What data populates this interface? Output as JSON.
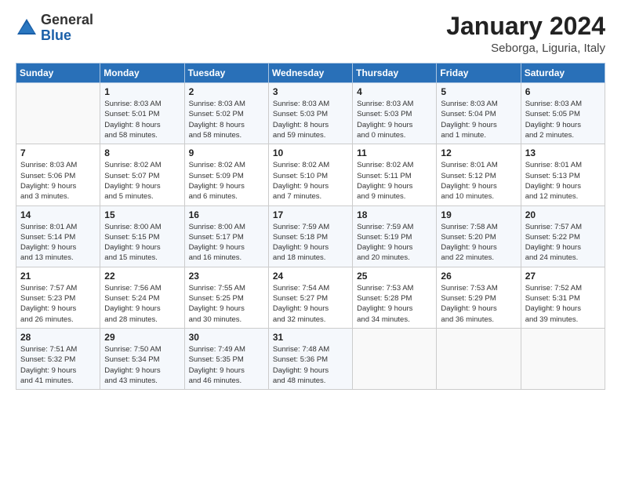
{
  "logo": {
    "general": "General",
    "blue": "Blue"
  },
  "header": {
    "month_year": "January 2024",
    "location": "Seborga, Liguria, Italy"
  },
  "weekdays": [
    "Sunday",
    "Monday",
    "Tuesday",
    "Wednesday",
    "Thursday",
    "Friday",
    "Saturday"
  ],
  "weeks": [
    [
      {
        "day": "",
        "detail": ""
      },
      {
        "day": "1",
        "detail": "Sunrise: 8:03 AM\nSunset: 5:01 PM\nDaylight: 8 hours\nand 58 minutes."
      },
      {
        "day": "2",
        "detail": "Sunrise: 8:03 AM\nSunset: 5:02 PM\nDaylight: 8 hours\nand 58 minutes."
      },
      {
        "day": "3",
        "detail": "Sunrise: 8:03 AM\nSunset: 5:03 PM\nDaylight: 8 hours\nand 59 minutes."
      },
      {
        "day": "4",
        "detail": "Sunrise: 8:03 AM\nSunset: 5:03 PM\nDaylight: 9 hours\nand 0 minutes."
      },
      {
        "day": "5",
        "detail": "Sunrise: 8:03 AM\nSunset: 5:04 PM\nDaylight: 9 hours\nand 1 minute."
      },
      {
        "day": "6",
        "detail": "Sunrise: 8:03 AM\nSunset: 5:05 PM\nDaylight: 9 hours\nand 2 minutes."
      }
    ],
    [
      {
        "day": "7",
        "detail": "Sunrise: 8:03 AM\nSunset: 5:06 PM\nDaylight: 9 hours\nand 3 minutes."
      },
      {
        "day": "8",
        "detail": "Sunrise: 8:02 AM\nSunset: 5:07 PM\nDaylight: 9 hours\nand 5 minutes."
      },
      {
        "day": "9",
        "detail": "Sunrise: 8:02 AM\nSunset: 5:09 PM\nDaylight: 9 hours\nand 6 minutes."
      },
      {
        "day": "10",
        "detail": "Sunrise: 8:02 AM\nSunset: 5:10 PM\nDaylight: 9 hours\nand 7 minutes."
      },
      {
        "day": "11",
        "detail": "Sunrise: 8:02 AM\nSunset: 5:11 PM\nDaylight: 9 hours\nand 9 minutes."
      },
      {
        "day": "12",
        "detail": "Sunrise: 8:01 AM\nSunset: 5:12 PM\nDaylight: 9 hours\nand 10 minutes."
      },
      {
        "day": "13",
        "detail": "Sunrise: 8:01 AM\nSunset: 5:13 PM\nDaylight: 9 hours\nand 12 minutes."
      }
    ],
    [
      {
        "day": "14",
        "detail": "Sunrise: 8:01 AM\nSunset: 5:14 PM\nDaylight: 9 hours\nand 13 minutes."
      },
      {
        "day": "15",
        "detail": "Sunrise: 8:00 AM\nSunset: 5:15 PM\nDaylight: 9 hours\nand 15 minutes."
      },
      {
        "day": "16",
        "detail": "Sunrise: 8:00 AM\nSunset: 5:17 PM\nDaylight: 9 hours\nand 16 minutes."
      },
      {
        "day": "17",
        "detail": "Sunrise: 7:59 AM\nSunset: 5:18 PM\nDaylight: 9 hours\nand 18 minutes."
      },
      {
        "day": "18",
        "detail": "Sunrise: 7:59 AM\nSunset: 5:19 PM\nDaylight: 9 hours\nand 20 minutes."
      },
      {
        "day": "19",
        "detail": "Sunrise: 7:58 AM\nSunset: 5:20 PM\nDaylight: 9 hours\nand 22 minutes."
      },
      {
        "day": "20",
        "detail": "Sunrise: 7:57 AM\nSunset: 5:22 PM\nDaylight: 9 hours\nand 24 minutes."
      }
    ],
    [
      {
        "day": "21",
        "detail": "Sunrise: 7:57 AM\nSunset: 5:23 PM\nDaylight: 9 hours\nand 26 minutes."
      },
      {
        "day": "22",
        "detail": "Sunrise: 7:56 AM\nSunset: 5:24 PM\nDaylight: 9 hours\nand 28 minutes."
      },
      {
        "day": "23",
        "detail": "Sunrise: 7:55 AM\nSunset: 5:25 PM\nDaylight: 9 hours\nand 30 minutes."
      },
      {
        "day": "24",
        "detail": "Sunrise: 7:54 AM\nSunset: 5:27 PM\nDaylight: 9 hours\nand 32 minutes."
      },
      {
        "day": "25",
        "detail": "Sunrise: 7:53 AM\nSunset: 5:28 PM\nDaylight: 9 hours\nand 34 minutes."
      },
      {
        "day": "26",
        "detail": "Sunrise: 7:53 AM\nSunset: 5:29 PM\nDaylight: 9 hours\nand 36 minutes."
      },
      {
        "day": "27",
        "detail": "Sunrise: 7:52 AM\nSunset: 5:31 PM\nDaylight: 9 hours\nand 39 minutes."
      }
    ],
    [
      {
        "day": "28",
        "detail": "Sunrise: 7:51 AM\nSunset: 5:32 PM\nDaylight: 9 hours\nand 41 minutes."
      },
      {
        "day": "29",
        "detail": "Sunrise: 7:50 AM\nSunset: 5:34 PM\nDaylight: 9 hours\nand 43 minutes."
      },
      {
        "day": "30",
        "detail": "Sunrise: 7:49 AM\nSunset: 5:35 PM\nDaylight: 9 hours\nand 46 minutes."
      },
      {
        "day": "31",
        "detail": "Sunrise: 7:48 AM\nSunset: 5:36 PM\nDaylight: 9 hours\nand 48 minutes."
      },
      {
        "day": "",
        "detail": ""
      },
      {
        "day": "",
        "detail": ""
      },
      {
        "day": "",
        "detail": ""
      }
    ]
  ]
}
